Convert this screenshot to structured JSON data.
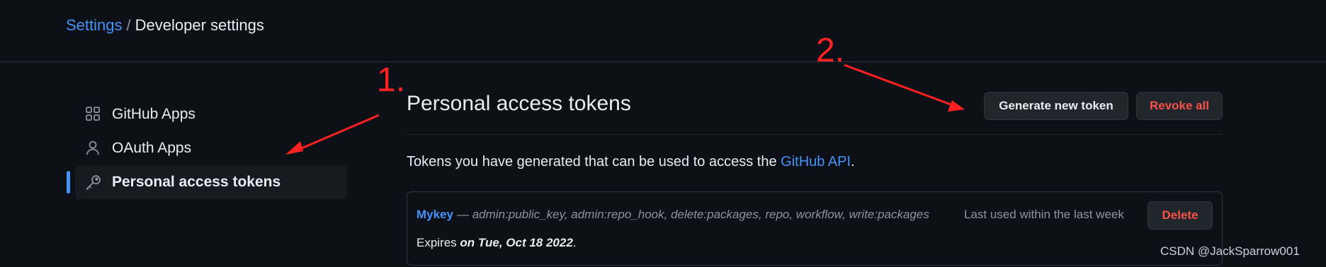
{
  "breadcrumb": {
    "parent": "Settings",
    "separator": "/",
    "current": "Developer settings"
  },
  "sidebar": {
    "items": [
      {
        "label": "GitHub Apps",
        "icon": "apps-grid-icon",
        "active": false
      },
      {
        "label": "OAuth Apps",
        "icon": "person-icon",
        "active": false
      },
      {
        "label": "Personal access tokens",
        "icon": "key-icon",
        "active": true
      }
    ]
  },
  "main": {
    "title": "Personal access tokens",
    "generate_button": "Generate new token",
    "revoke_button": "Revoke all",
    "description_prefix": "Tokens you have generated that can be used to access the ",
    "description_link": "GitHub API",
    "description_suffix": ".",
    "token": {
      "name": "Mykey",
      "scopes": "— admin:public_key, admin:repo_hook, delete:packages, repo, workflow, write:packages",
      "last_used": "Last used within the last week",
      "delete_button": "Delete",
      "expires_prefix": "Expires ",
      "expires_date": "on Tue, Oct 18 2022",
      "expires_suffix": "."
    }
  },
  "annotations": {
    "step1": "1.",
    "step2": "2.",
    "color": "#ff2020"
  },
  "watermark": "CSDN @JackSparrow001",
  "colors": {
    "background": "#0d1117",
    "link": "#4493f8",
    "danger": "#f85149",
    "active_indicator": "#4493f8"
  }
}
